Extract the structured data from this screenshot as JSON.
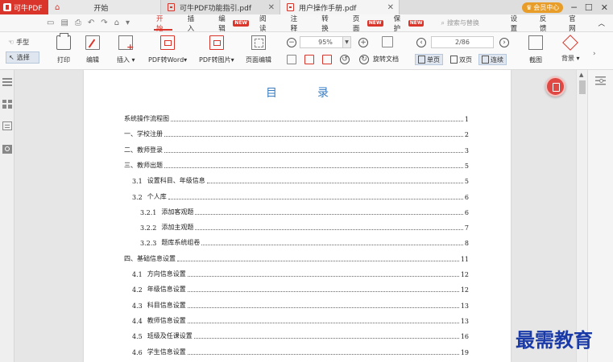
{
  "app": {
    "brand": "可牛PDF"
  },
  "tabs": [
    {
      "label": "开始",
      "type": "home"
    },
    {
      "label": "可牛PDF功能指引.pdf",
      "type": "doc"
    },
    {
      "label": "用户操作手册.pdf",
      "type": "doc",
      "active": true
    }
  ],
  "title_right": {
    "vip": "会员中心"
  },
  "menu": {
    "items": [
      {
        "label": "开始",
        "active": true
      },
      {
        "label": "插入"
      },
      {
        "label": "编辑",
        "badge": "NEW"
      },
      {
        "label": "阅读"
      },
      {
        "label": "注释"
      },
      {
        "label": "转换"
      },
      {
        "label": "页面",
        "badge": "NEW"
      },
      {
        "label": "保护",
        "badge": "NEW"
      }
    ],
    "search_placeholder": "搜索与替换",
    "right_items": [
      "设置",
      "反馈",
      "官网"
    ]
  },
  "toolbar": {
    "hand": "手型",
    "select": "选择",
    "print": "打印",
    "edit": "编辑",
    "insert": "插入",
    "pdf_to_word": "PDF转Word",
    "pdf_to_image": "PDF转图片",
    "page_edit": "页面编辑",
    "zoom": "95%",
    "rotate_doc": "旋转文档",
    "page_indicator": "2/86",
    "single_page": "单页",
    "double_page": "双页",
    "continuous": "连续",
    "screenshot": "截图",
    "background": "背景"
  },
  "document": {
    "title": "目录",
    "toc": [
      {
        "level": 0,
        "num": "",
        "text": "系统操作流程图",
        "page": "1"
      },
      {
        "level": 0,
        "num": "",
        "text": "一、学校注册",
        "page": "2"
      },
      {
        "level": 0,
        "num": "",
        "text": "二、教师登录",
        "page": "3"
      },
      {
        "level": 0,
        "num": "",
        "text": "三、教师出题",
        "page": "5"
      },
      {
        "level": 1,
        "num": "3.1",
        "text": "设置科目、年级信息",
        "page": "5"
      },
      {
        "level": 1,
        "num": "3.2",
        "text": "个人库",
        "page": "6"
      },
      {
        "level": 2,
        "num": "3.2.1",
        "text": "添加客观题",
        "page": "6"
      },
      {
        "level": 2,
        "num": "3.2.2",
        "text": "添加主观题",
        "page": "7"
      },
      {
        "level": 2,
        "num": "3.2.3",
        "text": "题库系统组卷",
        "page": "8"
      },
      {
        "level": 0,
        "num": "",
        "text": "四、基础信息设置",
        "page": "11"
      },
      {
        "level": 1,
        "num": "4.1",
        "text": "方向信息设置",
        "page": "12"
      },
      {
        "level": 1,
        "num": "4.2",
        "text": "年级信息设置",
        "page": "12"
      },
      {
        "level": 1,
        "num": "4.3",
        "text": "科目信息设置",
        "page": "13"
      },
      {
        "level": 1,
        "num": "4.4",
        "text": "教师信息设置",
        "page": "13"
      },
      {
        "level": 1,
        "num": "4.5",
        "text": "班级及任课设置",
        "page": "16"
      },
      {
        "level": 1,
        "num": "4.6",
        "text": "学生信息设置",
        "page": "19"
      }
    ]
  },
  "watermark": "最需教育"
}
